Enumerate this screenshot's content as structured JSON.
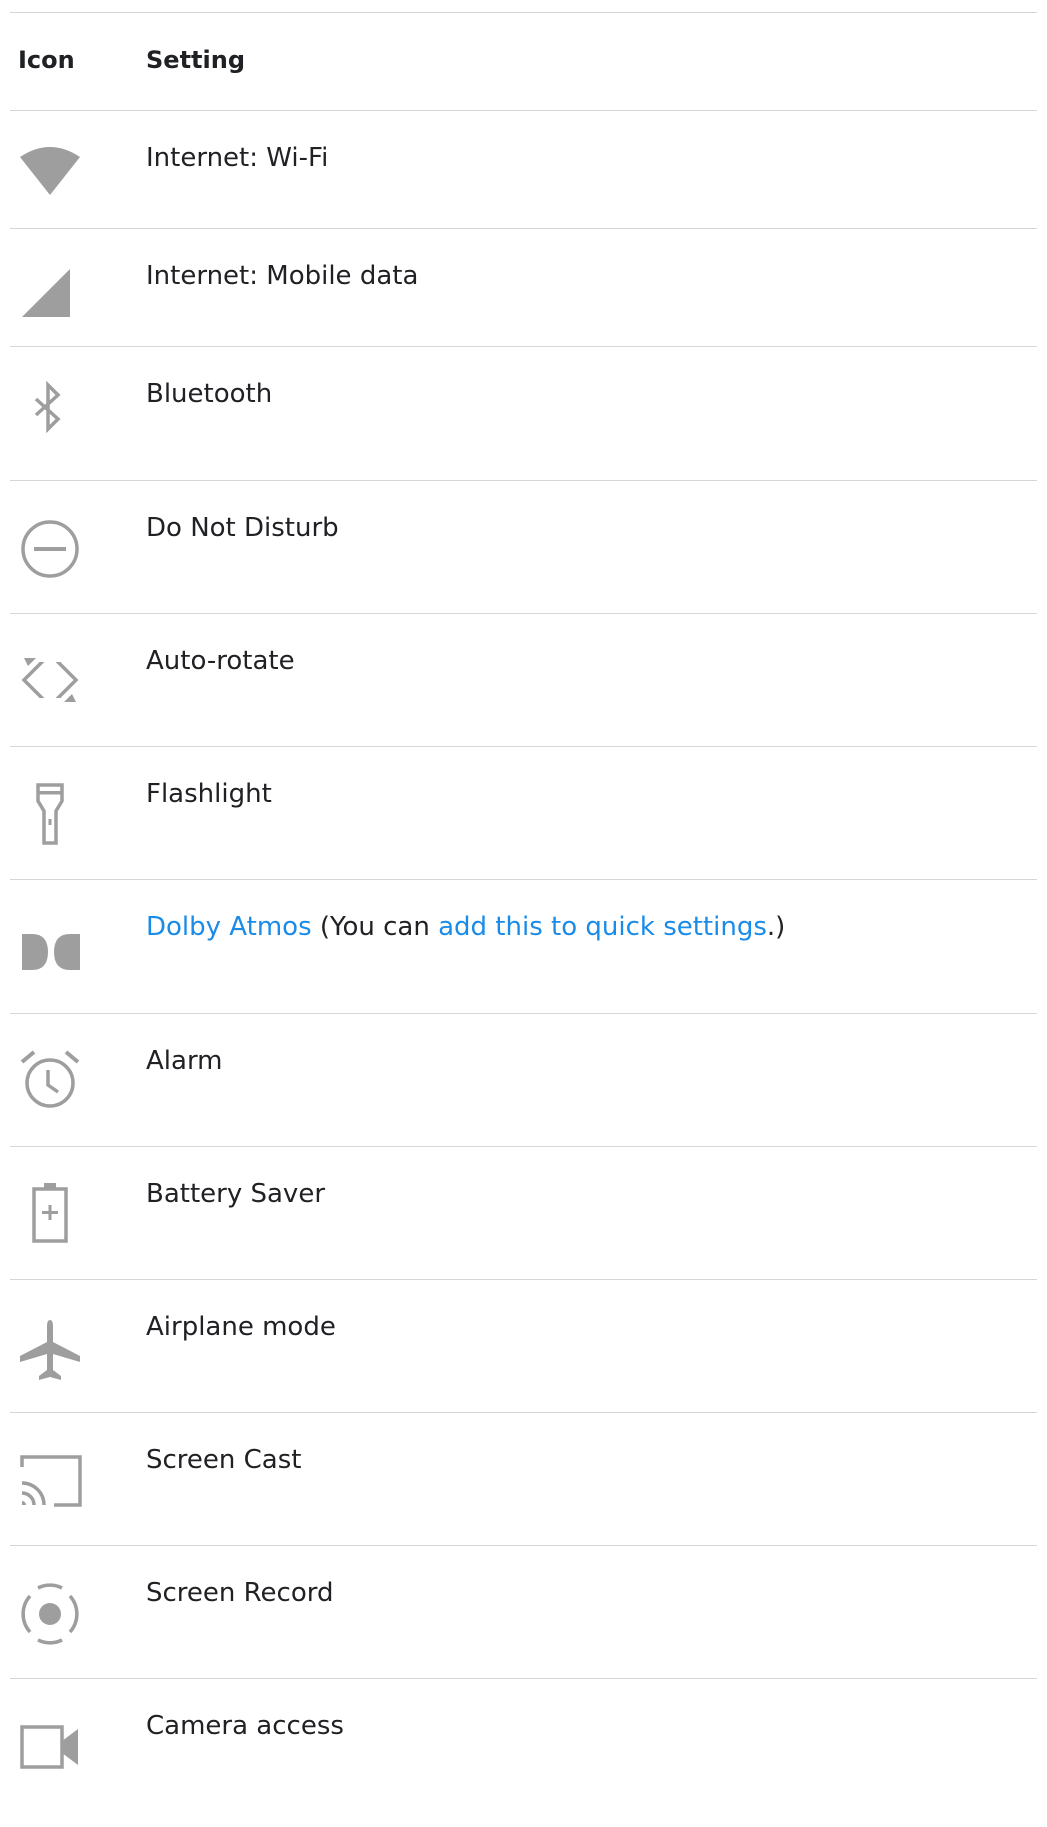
{
  "header": {
    "icon": "Icon",
    "setting": "Setting"
  },
  "rows": [
    {
      "icon": "wifi-icon",
      "label": "Internet: Wi-Fi"
    },
    {
      "icon": "mobile-signal-icon",
      "label": "Internet: Mobile data"
    },
    {
      "icon": "bluetooth-icon",
      "label": "Bluetooth"
    },
    {
      "icon": "do-not-disturb-icon",
      "label": "Do Not Disturb"
    },
    {
      "icon": "auto-rotate-icon",
      "label": "Auto-rotate"
    },
    {
      "icon": "flashlight-icon",
      "label": "Flashlight"
    },
    {
      "icon": "dolby-icon",
      "label": "Dolby Atmos",
      "note_pre": " (You can ",
      "note_link": "add this to quick settings",
      "note_post": ".)"
    },
    {
      "icon": "alarm-icon",
      "label": "Alarm"
    },
    {
      "icon": "battery-saver-icon",
      "label": "Battery Saver"
    },
    {
      "icon": "airplane-icon",
      "label": "Airplane mode"
    },
    {
      "icon": "screen-cast-icon",
      "label": "Screen Cast"
    },
    {
      "icon": "screen-record-icon",
      "label": "Screen Record"
    },
    {
      "icon": "camera-icon",
      "label": "Camera access"
    }
  ],
  "colors": {
    "link": "#1a8ce8",
    "icon": "#9e9e9e",
    "divider": "#d6d6d6"
  }
}
